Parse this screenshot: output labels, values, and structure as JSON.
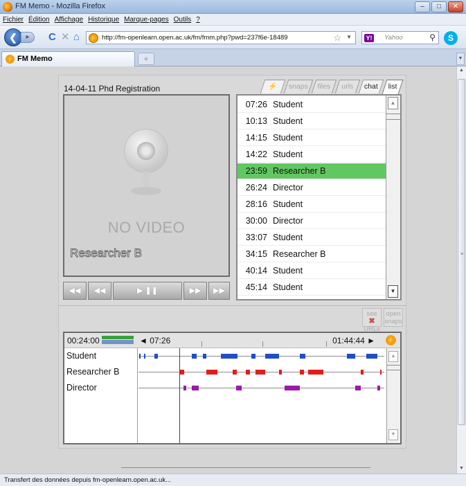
{
  "window": {
    "title": "FM Memo - Mozilla Firefox",
    "buttons": [
      "–",
      "□",
      "✕"
    ]
  },
  "menu": [
    "Fichier",
    "Édition",
    "Affichage",
    "Historique",
    "Marque-pages",
    "Outils",
    "?"
  ],
  "nav": {
    "url": "http://fm-openlearn.open.ac.uk/fm/fmm.php?pwd=237f6e-18489",
    "search_placeholder": "Yahoo",
    "search_engine": "Y!"
  },
  "browser_tab": {
    "label": "FM Memo",
    "new_tab": "+"
  },
  "status_text": "Transfert des données depuis fm-openlearn.open.ac.uk...",
  "app": {
    "session_title": "14-04-11  Phd Registration",
    "no_video": "NO VIDEO",
    "current_speaker": "Researcher B",
    "tabs": [
      {
        "label": "⚡",
        "state": "on"
      },
      {
        "label": "snaps",
        "state": "off"
      },
      {
        "label": "files",
        "state": "off"
      },
      {
        "label": "urls",
        "state": "off"
      },
      {
        "label": "chat",
        "state": "on"
      },
      {
        "label": "list",
        "state": "active"
      }
    ],
    "list": [
      {
        "time": "07:26",
        "name": "Student",
        "selected": false
      },
      {
        "time": "10:13",
        "name": "Student",
        "selected": false
      },
      {
        "time": "14:15",
        "name": "Student",
        "selected": false
      },
      {
        "time": "14:22",
        "name": "Student",
        "selected": false
      },
      {
        "time": "23:59",
        "name": "Researcher B",
        "selected": true
      },
      {
        "time": "26:24",
        "name": "Director",
        "selected": false
      },
      {
        "time": "28:16",
        "name": "Student",
        "selected": false
      },
      {
        "time": "30:00",
        "name": "Director",
        "selected": false
      },
      {
        "time": "33:07",
        "name": "Student",
        "selected": false
      },
      {
        "time": "34:15",
        "name": "Researcher B",
        "selected": false
      },
      {
        "time": "40:14",
        "name": "Student",
        "selected": false
      },
      {
        "time": "45:14",
        "name": "Student",
        "selected": false
      }
    ],
    "buttons": {
      "see_urls": [
        "see",
        "URLs"
      ],
      "open_snaps": [
        "open",
        "snaps"
      ]
    },
    "timeline": {
      "start": "00:24:00",
      "current": "◄ 07:26",
      "end": "01:44:44 ►",
      "participants": [
        {
          "name": "Student",
          "color": "#1f4fc7"
        },
        {
          "name": "Researcher B",
          "color": "#e41c1c"
        },
        {
          "name": "Director",
          "color": "#9b1aa8"
        }
      ]
    }
  },
  "colors": {
    "selected_row": "#61c861",
    "student": "#1f4fc7",
    "researcher": "#e41c1c",
    "director": "#9b1aa8"
  }
}
